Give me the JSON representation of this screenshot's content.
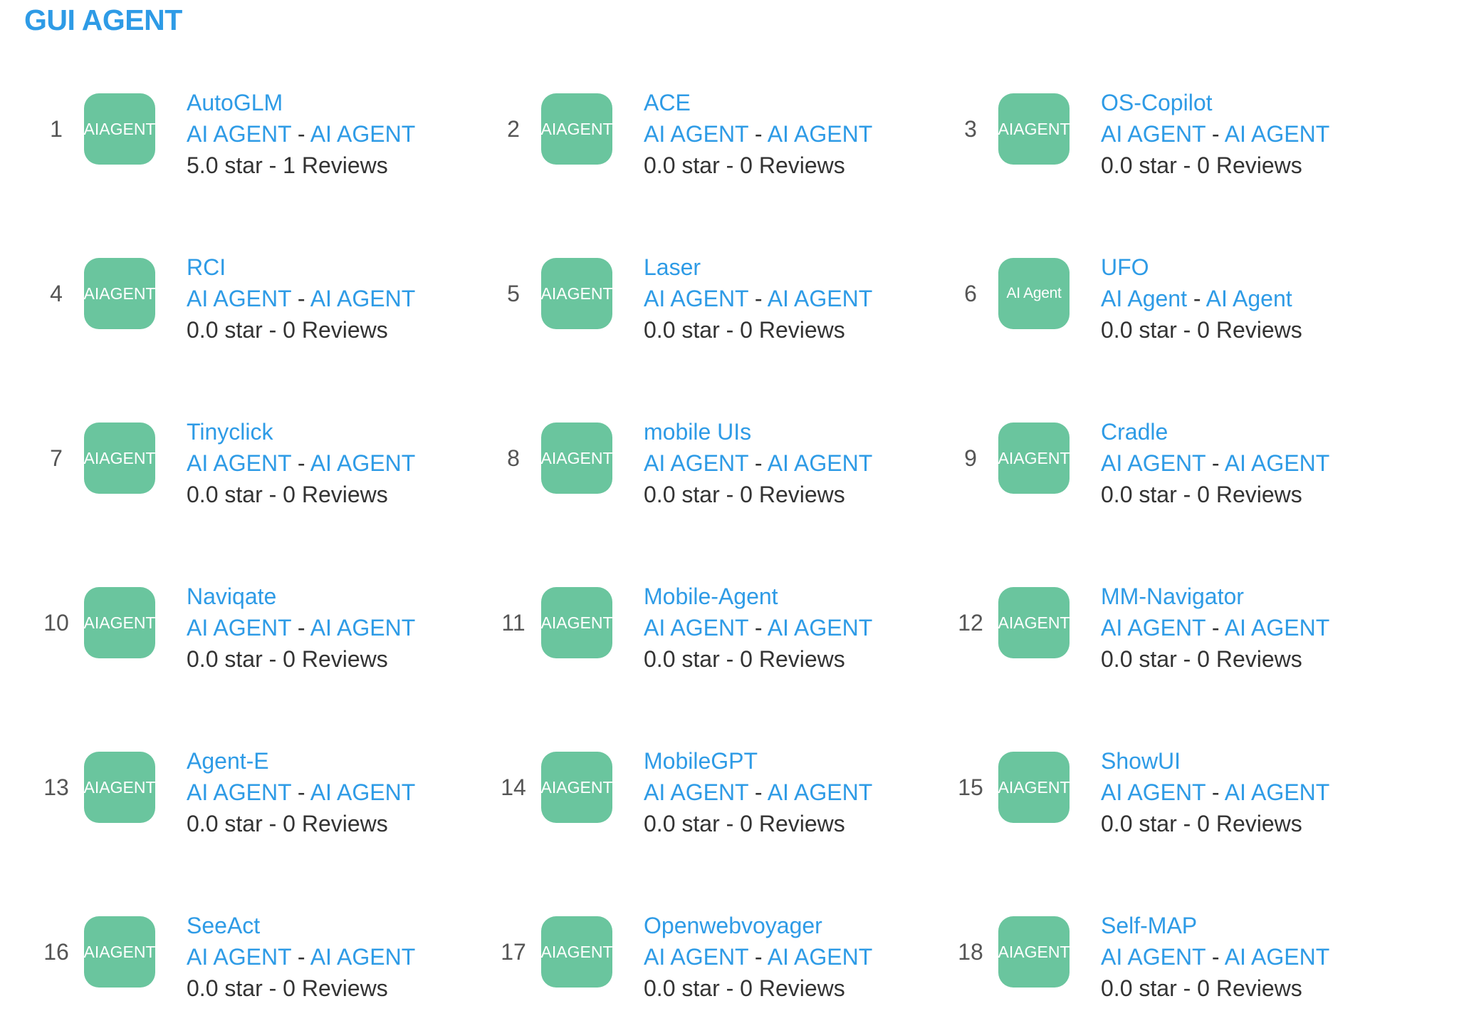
{
  "section": {
    "title": "GUI AGENT"
  },
  "colors": {
    "accent": "#2e9be6",
    "icon_bg": "#6ac59e",
    "text": "#333333",
    "rank_text": "#555555"
  },
  "items": [
    {
      "rank": "1",
      "icon_text": [
        "AI",
        "AGENT"
      ],
      "name": "AutoGLM",
      "category": "AI AGENT",
      "subcategory": "AI AGENT",
      "rating": "5.0 star - 1 Reviews"
    },
    {
      "rank": "2",
      "icon_text": [
        "AI",
        "AGENT"
      ],
      "name": "ACE",
      "category": "AI AGENT",
      "subcategory": "AI AGENT",
      "rating": "0.0 star - 0 Reviews"
    },
    {
      "rank": "3",
      "icon_text": [
        "AI",
        "AGENT"
      ],
      "name": "OS-Copilot",
      "category": "AI AGENT",
      "subcategory": "AI AGENT",
      "rating": "0.0 star - 0 Reviews"
    },
    {
      "rank": "4",
      "icon_text": [
        "AI",
        "AGENT"
      ],
      "name": "RCI",
      "category": "AI AGENT",
      "subcategory": "AI AGENT",
      "rating": "0.0 star - 0 Reviews"
    },
    {
      "rank": "5",
      "icon_text": [
        "AI",
        "AGENT"
      ],
      "name": "Laser",
      "category": "AI AGENT",
      "subcategory": "AI AGENT",
      "rating": "0.0 star - 0 Reviews"
    },
    {
      "rank": "6",
      "icon_text": [
        "AI Agent"
      ],
      "name": "UFO",
      "category": "AI Agent",
      "subcategory": "AI Agent",
      "rating": "0.0 star - 0 Reviews"
    },
    {
      "rank": "7",
      "icon_text": [
        "AI",
        "AGENT"
      ],
      "name": "Tinyclick",
      "category": "AI AGENT",
      "subcategory": "AI AGENT",
      "rating": "0.0 star - 0 Reviews"
    },
    {
      "rank": "8",
      "icon_text": [
        "AI",
        "AGENT"
      ],
      "name": "mobile UIs",
      "category": "AI AGENT",
      "subcategory": "AI AGENT",
      "rating": "0.0 star - 0 Reviews"
    },
    {
      "rank": "9",
      "icon_text": [
        "AI",
        "AGENT"
      ],
      "name": "Cradle",
      "category": "AI AGENT",
      "subcategory": "AI AGENT",
      "rating": "0.0 star - 0 Reviews"
    },
    {
      "rank": "10",
      "icon_text": [
        "AI",
        "AGENT"
      ],
      "name": "Naviqate",
      "category": "AI AGENT",
      "subcategory": "AI AGENT",
      "rating": "0.0 star - 0 Reviews"
    },
    {
      "rank": "11",
      "icon_text": [
        "AI",
        "AGENT"
      ],
      "name": "Mobile-Agent",
      "category": "AI AGENT",
      "subcategory": "AI AGENT",
      "rating": "0.0 star - 0 Reviews"
    },
    {
      "rank": "12",
      "icon_text": [
        "AI",
        "AGENT"
      ],
      "name": "MM-Navigator",
      "category": "AI AGENT",
      "subcategory": "AI AGENT",
      "rating": "0.0 star - 0 Reviews"
    },
    {
      "rank": "13",
      "icon_text": [
        "AI",
        "AGENT"
      ],
      "name": "Agent-E",
      "category": "AI AGENT",
      "subcategory": "AI AGENT",
      "rating": "0.0 star - 0 Reviews"
    },
    {
      "rank": "14",
      "icon_text": [
        "AI",
        "AGENT"
      ],
      "name": "MobileGPT",
      "category": "AI AGENT",
      "subcategory": "AI AGENT",
      "rating": "0.0 star - 0 Reviews"
    },
    {
      "rank": "15",
      "icon_text": [
        "AI",
        "AGENT"
      ],
      "name": "ShowUI",
      "category": "AI AGENT",
      "subcategory": "AI AGENT",
      "rating": "0.0 star - 0 Reviews"
    },
    {
      "rank": "16",
      "icon_text": [
        "AI",
        "AGENT"
      ],
      "name": "SeeAct",
      "category": "AI AGENT",
      "subcategory": "AI AGENT",
      "rating": "0.0 star - 0 Reviews"
    },
    {
      "rank": "17",
      "icon_text": [
        "AI",
        "AGENT"
      ],
      "name": "Openwebvoyager",
      "category": "AI AGENT",
      "subcategory": "AI AGENT",
      "rating": "0.0 star - 0 Reviews"
    },
    {
      "rank": "18",
      "icon_text": [
        "AI",
        "AGENT"
      ],
      "name": "Self-MAP",
      "category": "AI AGENT",
      "subcategory": "AI AGENT",
      "rating": "0.0 star - 0 Reviews"
    }
  ],
  "separator": "-"
}
